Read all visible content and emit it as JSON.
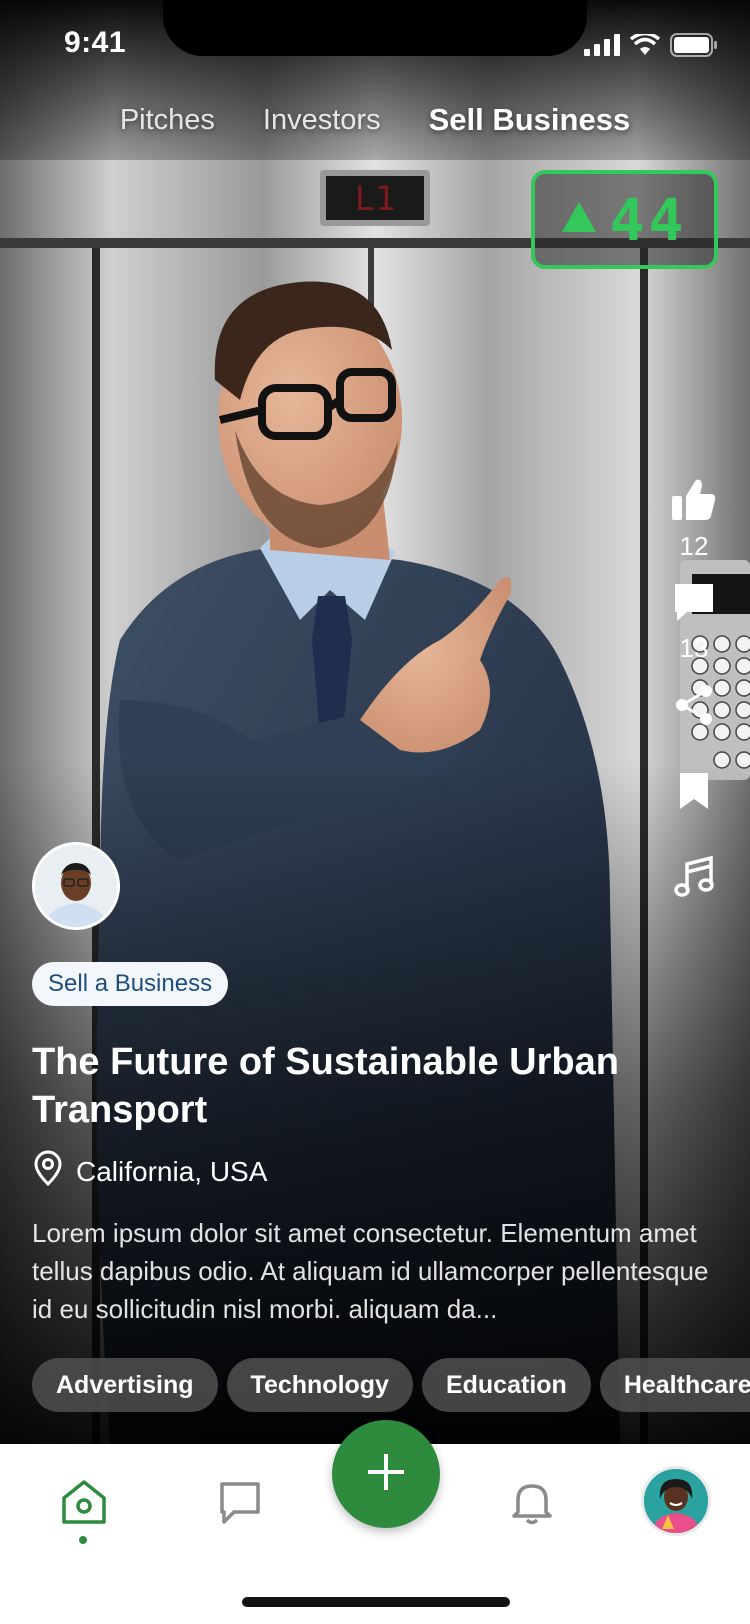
{
  "status_bar": {
    "time": "9:41"
  },
  "top_tabs": [
    {
      "label": "Pitches",
      "active": false
    },
    {
      "label": "Investors",
      "active": false
    },
    {
      "label": "Sell Business",
      "active": true
    }
  ],
  "elevator": {
    "indicator_label": "L1",
    "floor_number": "44",
    "direction": "up",
    "accent": "#34c759"
  },
  "rail": {
    "likes": "12",
    "comments": "13",
    "icons": [
      "thumbs-up-icon",
      "comment-icon",
      "share-icon",
      "bookmark-icon",
      "music-icon"
    ]
  },
  "post": {
    "category": "Sell a Business",
    "title": "The Future of Sustainable Urban Transport",
    "location": "California, USA",
    "description": "Lorem ipsum dolor sit amet consectetur. Elementum amet tellus dapibus odio. At aliquam id ullamcorper pellentesque id eu sollicitudin nisl morbi. aliquam da...",
    "tags": [
      "Advertising",
      "Technology",
      "Education",
      "Healthcare"
    ]
  },
  "bottom_nav": {
    "items": [
      "home-icon",
      "chat-icon",
      "add-icon",
      "bell-icon",
      "profile-avatar"
    ],
    "active": "home",
    "accent": "#2e8b3e"
  }
}
